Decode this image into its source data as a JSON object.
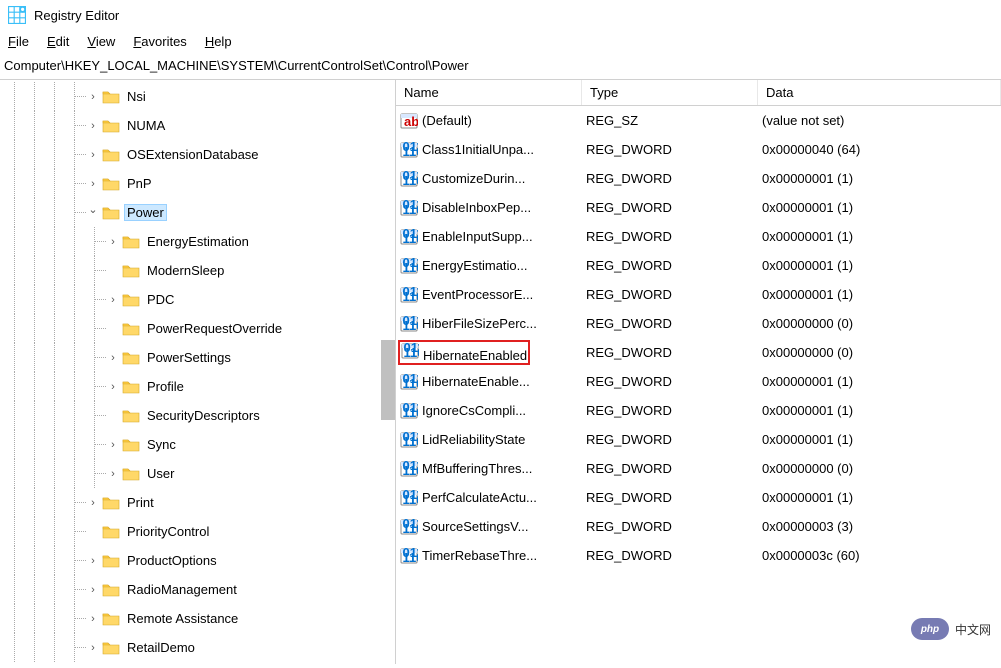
{
  "app": {
    "title": "Registry Editor",
    "address": "Computer\\HKEY_LOCAL_MACHINE\\SYSTEM\\CurrentControlSet\\Control\\Power"
  },
  "menu": {
    "file": "File",
    "edit": "Edit",
    "view": "View",
    "favorites": "Favorites",
    "help": "Help"
  },
  "tree": {
    "items": [
      {
        "label": "Nsi",
        "depth": 5,
        "exp": "›"
      },
      {
        "label": "NUMA",
        "depth": 5,
        "exp": "›"
      },
      {
        "label": "OSExtensionDatabase",
        "depth": 5,
        "exp": "›"
      },
      {
        "label": "PnP",
        "depth": 5,
        "exp": "›"
      },
      {
        "label": "Power",
        "depth": 5,
        "exp": "⌄",
        "selected": true
      },
      {
        "label": "EnergyEstimation",
        "depth": 6,
        "exp": "›"
      },
      {
        "label": "ModernSleep",
        "depth": 6,
        "exp": ""
      },
      {
        "label": "PDC",
        "depth": 6,
        "exp": "›"
      },
      {
        "label": "PowerRequestOverride",
        "depth": 6,
        "exp": ""
      },
      {
        "label": "PowerSettings",
        "depth": 6,
        "exp": "›"
      },
      {
        "label": "Profile",
        "depth": 6,
        "exp": "›"
      },
      {
        "label": "SecurityDescriptors",
        "depth": 6,
        "exp": ""
      },
      {
        "label": "Sync",
        "depth": 6,
        "exp": "›"
      },
      {
        "label": "User",
        "depth": 6,
        "exp": "›"
      },
      {
        "label": "Print",
        "depth": 5,
        "exp": "›"
      },
      {
        "label": "PriorityControl",
        "depth": 5,
        "exp": ""
      },
      {
        "label": "ProductOptions",
        "depth": 5,
        "exp": "›"
      },
      {
        "label": "RadioManagement",
        "depth": 5,
        "exp": "›"
      },
      {
        "label": "Remote Assistance",
        "depth": 5,
        "exp": "›"
      },
      {
        "label": "RetailDemo",
        "depth": 5,
        "exp": "›"
      }
    ]
  },
  "list": {
    "headers": {
      "name": "Name",
      "type": "Type",
      "data": "Data"
    },
    "rows": [
      {
        "icon": "string",
        "name": "(Default)",
        "type": "REG_SZ",
        "data": "(value not set)"
      },
      {
        "icon": "binary",
        "name": "Class1InitialUnpa...",
        "type": "REG_DWORD",
        "data": "0x00000040 (64)"
      },
      {
        "icon": "binary",
        "name": "CustomizeDurin...",
        "type": "REG_DWORD",
        "data": "0x00000001 (1)"
      },
      {
        "icon": "binary",
        "name": "DisableInboxPep...",
        "type": "REG_DWORD",
        "data": "0x00000001 (1)"
      },
      {
        "icon": "binary",
        "name": "EnableInputSupp...",
        "type": "REG_DWORD",
        "data": "0x00000001 (1)"
      },
      {
        "icon": "binary",
        "name": "EnergyEstimatio...",
        "type": "REG_DWORD",
        "data": "0x00000001 (1)"
      },
      {
        "icon": "binary",
        "name": "EventProcessorE...",
        "type": "REG_DWORD",
        "data": "0x00000001 (1)"
      },
      {
        "icon": "binary",
        "name": "HiberFileSizePerc...",
        "type": "REG_DWORD",
        "data": "0x00000000 (0)"
      },
      {
        "icon": "binary",
        "name": "HibernateEnabled",
        "type": "REG_DWORD",
        "data": "0x00000000 (0)",
        "highlight": true
      },
      {
        "icon": "binary",
        "name": "HibernateEnable...",
        "type": "REG_DWORD",
        "data": "0x00000001 (1)"
      },
      {
        "icon": "binary",
        "name": "IgnoreCsCompli...",
        "type": "REG_DWORD",
        "data": "0x00000001 (1)"
      },
      {
        "icon": "binary",
        "name": "LidReliabilityState",
        "type": "REG_DWORD",
        "data": "0x00000001 (1)"
      },
      {
        "icon": "binary",
        "name": "MfBufferingThres...",
        "type": "REG_DWORD",
        "data": "0x00000000 (0)"
      },
      {
        "icon": "binary",
        "name": "PerfCalculateActu...",
        "type": "REG_DWORD",
        "data": "0x00000001 (1)"
      },
      {
        "icon": "binary",
        "name": "SourceSettingsV...",
        "type": "REG_DWORD",
        "data": "0x00000003 (3)"
      },
      {
        "icon": "binary",
        "name": "TimerRebaseThre...",
        "type": "REG_DWORD",
        "data": "0x0000003c (60)"
      }
    ]
  },
  "badge": {
    "logo": "php",
    "text": "中文网"
  }
}
